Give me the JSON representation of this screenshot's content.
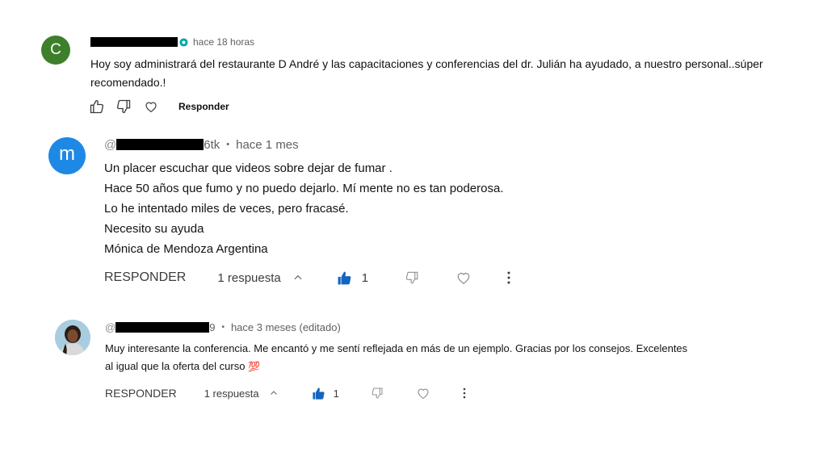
{
  "comments": [
    {
      "avatar_letter": "C",
      "avatar_color": "#3d7f2b",
      "handle_suffix": "",
      "time": "hace 18 horas",
      "lines": [
        "Hoy soy administrará del restaurante D André y las capacitaciones y conferencias del dr. Julián ha ayudado, a nuestro personal..súper",
        "recomendado.!"
      ],
      "reply_label": "Responder"
    },
    {
      "avatar_letter": "m",
      "avatar_color": "#1e88e5",
      "handle_prefix": "@",
      "handle_suffix": "6tk",
      "separator": "•",
      "time": "hace 1 mes",
      "lines": [
        "Un placer escuchar que videos sobre dejar de fumar .",
        "Hace 50 años que fumo y no puedo dejarlo. Mí mente no es tan poderosa.",
        "Lo he intentado miles de veces, pero fracasé.",
        "Necesito su ayuda",
        "Mónica de Mendoza Argentina"
      ],
      "reply_label": "RESPONDER",
      "replies_label": "1 respuesta",
      "like_count": "1"
    },
    {
      "avatar_letter": "",
      "handle_prefix": "@",
      "handle_suffix": "9",
      "separator": "•",
      "time": "hace 3 meses (editado)",
      "lines": [
        "Muy interesante la conferencia. Me encantó y me sentí reflejada en más de un ejemplo. Gracias por los consejos. Excelentes",
        "al igual que la oferta del curso"
      ],
      "emoji": "💯",
      "reply_label": "RESPONDER",
      "replies_label": "1 respuesta",
      "like_count": "1"
    }
  ],
  "colors": {
    "like_active": "#1565c0",
    "meta_gray": "#606060",
    "icon_gray": "#909090"
  },
  "icons": [
    "thumbs-up-icon",
    "thumbs-down-icon",
    "heart-icon",
    "more-vert-icon",
    "chevron-up-icon",
    "verified-icon"
  ]
}
